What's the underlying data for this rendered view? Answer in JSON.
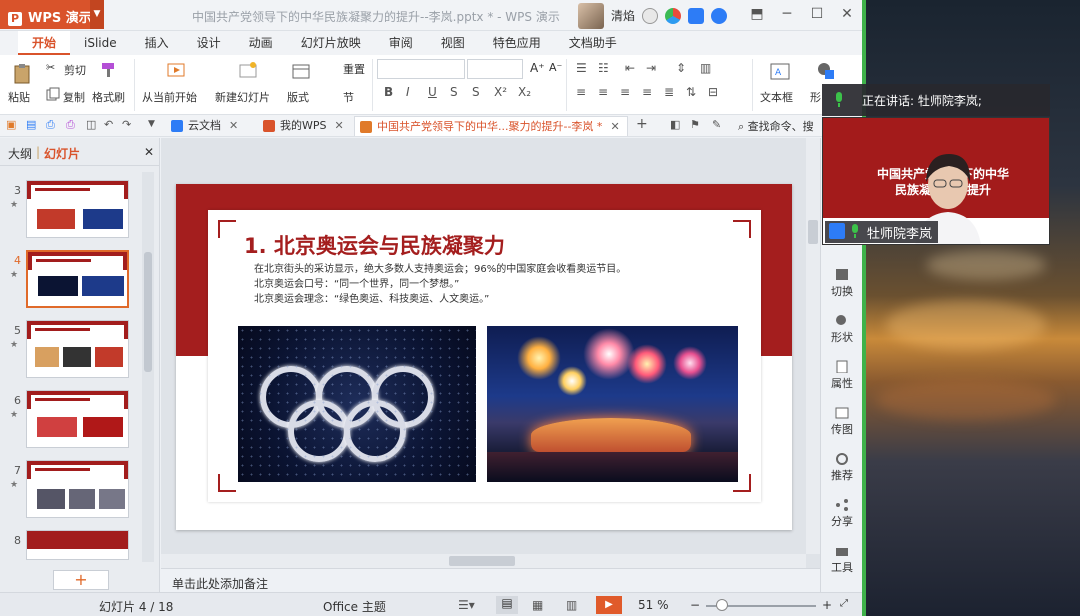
{
  "window": {
    "app_label": "WPS 演示",
    "title": "中国共产党领导下的中华民族凝聚力的提升--李岚.pptx * - WPS 演示",
    "user_name": "清焰"
  },
  "menu": [
    "开始",
    "iSlide",
    "插入",
    "设计",
    "动画",
    "幻灯片放映",
    "审阅",
    "视图",
    "特色应用",
    "文档助手"
  ],
  "ribbon": {
    "cut": "剪切",
    "paste": "粘贴",
    "copy": "复制",
    "format_painter": "格式刷",
    "from_current": "从当前开始",
    "new_slide": "新建幻灯片",
    "layout": "版式",
    "reset": "重置",
    "section": "节",
    "textbox": "文本框",
    "shape_partial": "形"
  },
  "doc_tabs": [
    {
      "label": "云文档"
    },
    {
      "label": "我的WPS"
    },
    {
      "label": "中国共产党领导下的中华...聚力的提升--李岚 *"
    }
  ],
  "search_cmd": "查找命令、搜",
  "left_panel": {
    "tab_outline": "大纲",
    "tab_slides": "幻灯片",
    "thumb_numbers": [
      "3",
      "4",
      "5",
      "6",
      "7",
      "8"
    ]
  },
  "slide": {
    "title": "1. 北京奥运会与民族凝聚力",
    "line1": "在北京街头的采访显示，绝大多数人支持奥运会；96%的中国家庭会收看奥运节目。",
    "line2": "北京奥运会口号：“同一个世界，同一个梦想。”",
    "line3": "北京奥运会理念：“绿色奥运、科技奥运、人文奥运。”"
  },
  "notes_placeholder": "单击此处添加备注",
  "right_pane": [
    "切换",
    "形状",
    "属性",
    "传图",
    "推荐",
    "分享",
    "工具"
  ],
  "status": {
    "slide_info": "幻灯片 4 / 18",
    "theme": "Office 主题",
    "zoom": "51 %"
  },
  "speaker": {
    "speaking": "正在讲话: 牡师院李岚;",
    "name": "牡师院李岚",
    "video_slide_title": "中国共产党领导下的中华民族凝聚力的提升"
  }
}
